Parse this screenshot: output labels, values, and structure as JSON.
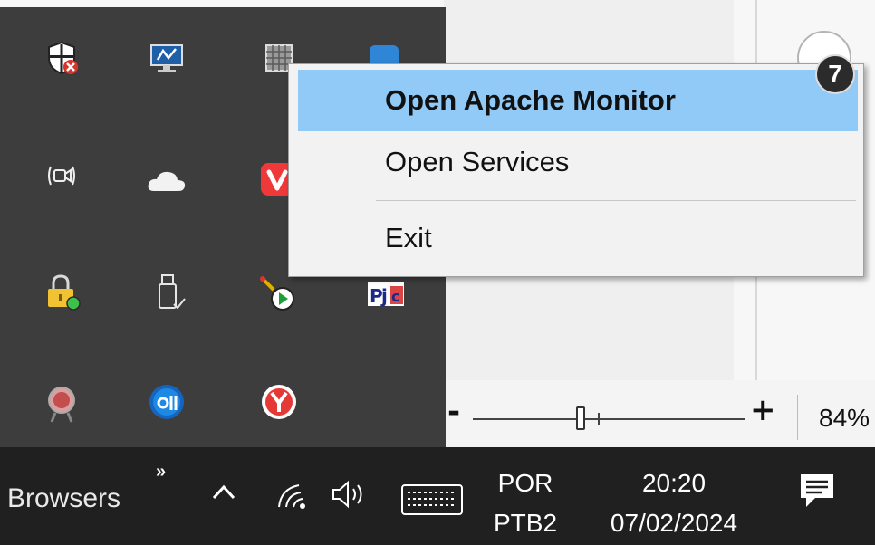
{
  "context_menu": {
    "items": [
      {
        "label": "Open Apache Monitor",
        "highlighted": true
      },
      {
        "label": "Open Services",
        "highlighted": false
      },
      {
        "label": "Exit",
        "highlighted": false
      }
    ]
  },
  "tray_icons": [
    "windows-security-warning-icon",
    "network-monitor-icon",
    "apache-monitor-icon",
    "blue-app-icon",
    "meet-now-icon",
    "onedrive-cloud-icon",
    "vivaldi-icon",
    "vpn-lock-icon",
    "usb-safely-remove-icon",
    "media-player-icon",
    "pjc-app-icon",
    "sync-app-icon",
    "blue-circle-app-icon",
    "yandex-browser-icon"
  ],
  "zoom": {
    "minus": "-",
    "plus": "+",
    "level": "84%"
  },
  "taskbar": {
    "toolbar_label": "Browsers",
    "toolbar_chevron": "»",
    "language_line1": "POR",
    "language_line2": "PTB2",
    "time": "20:20",
    "date": "07/02/2024",
    "notification_count": "7"
  },
  "colors": {
    "flyout_bg": "#3d3d3d",
    "taskbar_bg": "#202020",
    "menu_highlight": "#91c9f7",
    "menu_bg": "#f2f2f2"
  }
}
